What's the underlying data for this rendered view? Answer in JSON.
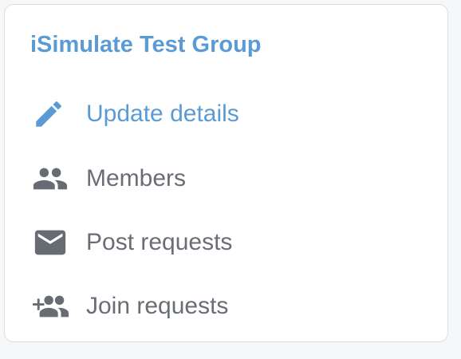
{
  "group": {
    "title": "iSimulate Test Group"
  },
  "menu": {
    "items": [
      {
        "label": "Update details",
        "icon": "pencil-icon",
        "active": true
      },
      {
        "label": "Members",
        "icon": "people-icon",
        "active": false
      },
      {
        "label": "Post requests",
        "icon": "envelope-icon",
        "active": false
      },
      {
        "label": "Join requests",
        "icon": "add-people-icon",
        "active": false
      }
    ]
  },
  "colors": {
    "accent": "#5b9bd5",
    "text": "#696d75",
    "icon": "#676b72",
    "card_border": "#dcdee3",
    "page_background": "#f6f7f9"
  }
}
